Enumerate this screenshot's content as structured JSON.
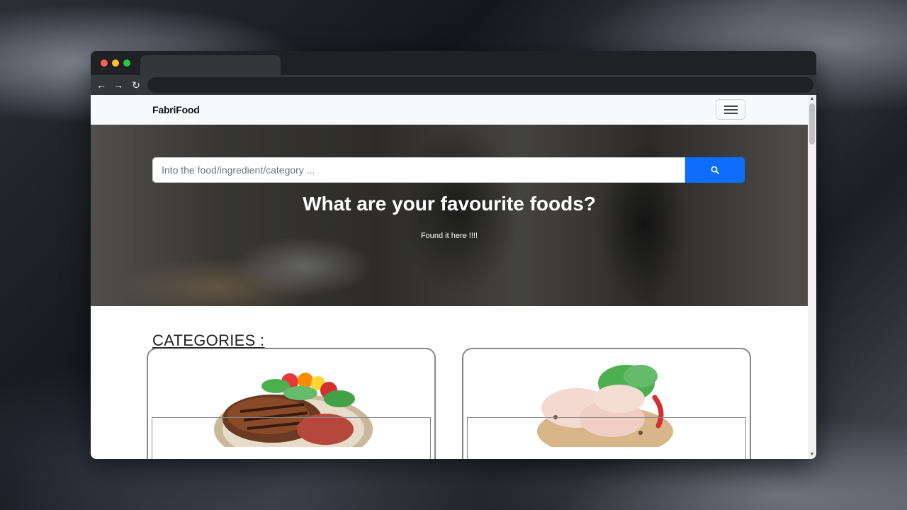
{
  "window": {
    "url": ""
  },
  "browser": {
    "back_icon": "←",
    "forward_icon": "→",
    "reload_icon": "↻",
    "scroll_up_icon": "▲",
    "scroll_down_icon": "▼"
  },
  "navbar": {
    "brand": "FabriFood",
    "menu_icon": "hamburger-icon"
  },
  "hero": {
    "search_placeholder": "Into the food/ingredient/category ...",
    "search_value": "",
    "title": "What are your favourite foods?",
    "subtitle": "Found it here !!!!"
  },
  "categories": {
    "heading": "CATEGORIES :",
    "cards": [
      {
        "image": "steak-plate"
      },
      {
        "image": "raw-chicken-plate"
      }
    ]
  },
  "colors": {
    "accent": "#0d6efd",
    "navbar_bg": "#f8f9fa",
    "browser_chrome": "#202124"
  }
}
